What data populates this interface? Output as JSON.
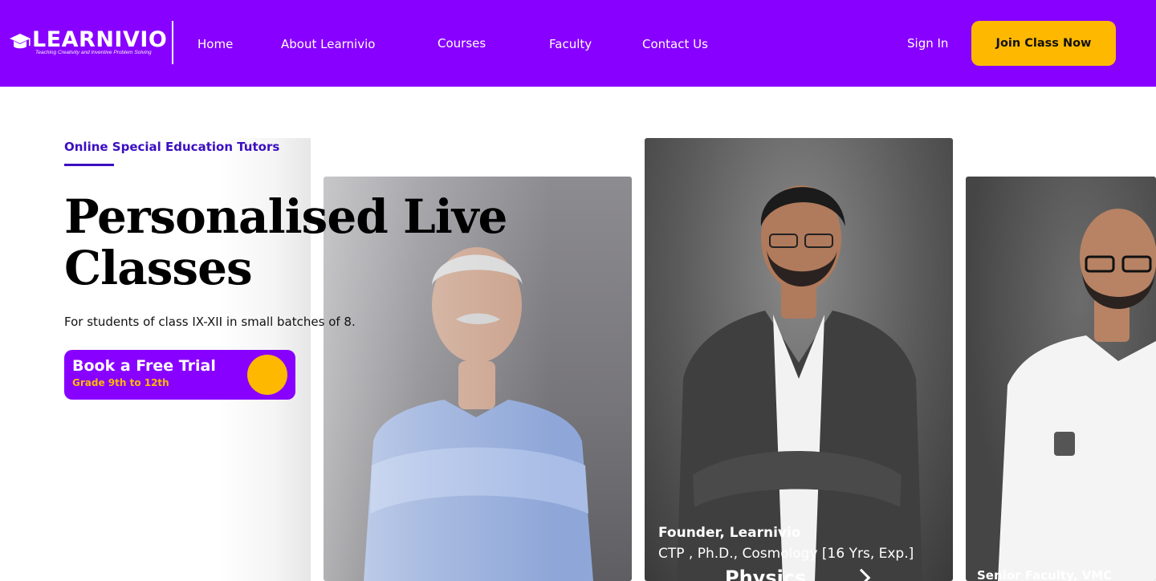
{
  "brand": {
    "name": "LEARNIVIO",
    "tagline": "Teaching Creativity and Inventive Problem Solving",
    "primary_color": "#8800ff",
    "accent_color": "#ffb800",
    "logo_icon": "graduation-cap-icon"
  },
  "nav": {
    "items": [
      {
        "label": "Home"
      },
      {
        "label": "About Learnivio"
      },
      {
        "label": "Courses"
      },
      {
        "label": "Faculty"
      },
      {
        "label": "Contact Us"
      }
    ],
    "sign_in": "Sign In",
    "join_cta": "Join Class Now"
  },
  "hero": {
    "eyebrow": "Online Special Education Tutors",
    "title_line1": "Personalised Live",
    "title_line2": "Classes",
    "subtitle": "For students of class IX-XII in small batches of 8.",
    "cta_title": "Book a Free Trial",
    "cta_subtitle": "Grade 9th to 12th"
  },
  "faculty_cards": [
    {
      "role": "",
      "qualifications": "",
      "subject": ""
    },
    {
      "role": "Founder, Learnivio",
      "qualifications": "CTP , Ph.D., Cosmology [16 Yrs, Exp.]",
      "subject": "Physics"
    },
    {
      "role": "Senior Faculty, VMC",
      "qualifications": "",
      "subject": ""
    }
  ]
}
